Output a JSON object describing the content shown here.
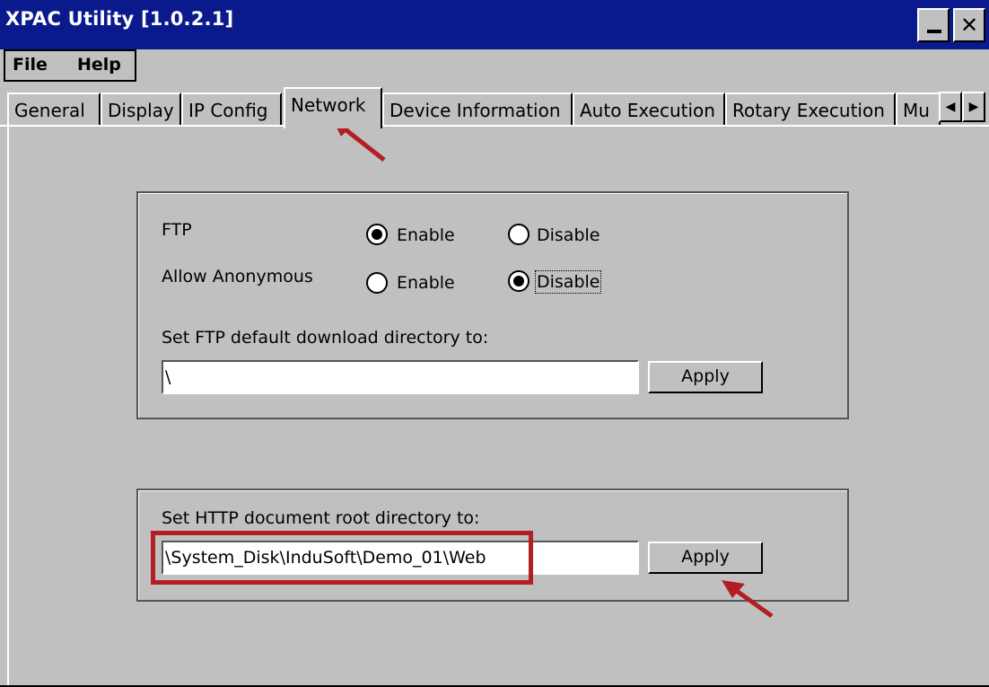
{
  "window": {
    "title": "XPAC Utility [1.0.2.1]"
  },
  "titlebar": {
    "minimize_icon": "minimize-icon",
    "close_icon": "close-icon",
    "close_glyph": "✕"
  },
  "menu": {
    "file": "File",
    "help": "Help"
  },
  "tabs": [
    {
      "label": "General",
      "active": false
    },
    {
      "label": "Display",
      "active": false
    },
    {
      "label": "IP Config",
      "active": false
    },
    {
      "label": "Network",
      "active": true
    },
    {
      "label": "Device Information",
      "active": false
    },
    {
      "label": "Auto Execution",
      "active": false
    },
    {
      "label": "Rotary Execution",
      "active": false
    },
    {
      "label": "Mu",
      "active": false
    }
  ],
  "tab_scroll": {
    "left_glyph": "◀",
    "right_glyph": "▶"
  },
  "ftp_group": {
    "ftp_label": "FTP",
    "ftp_enable": "Enable",
    "ftp_disable": "Disable",
    "ftp_selected": "Enable",
    "anon_label": "Allow Anonymous",
    "anon_enable": "Enable",
    "anon_disable": "Disable",
    "anon_selected": "Disable",
    "dir_label": "Set FTP default download directory to:",
    "dir_value": "\\",
    "apply_label": "Apply"
  },
  "http_group": {
    "dir_label": "Set HTTP document root directory to:",
    "dir_value": "\\System_Disk\\InduSoft\\Demo_01\\Web",
    "apply_label": "Apply"
  },
  "annotations": {
    "highlight_color": "#b31e24",
    "arrow_color": "#b31e24"
  },
  "colors": {
    "titlebar": "#0a1a8c",
    "face": "#c0c0c0"
  }
}
